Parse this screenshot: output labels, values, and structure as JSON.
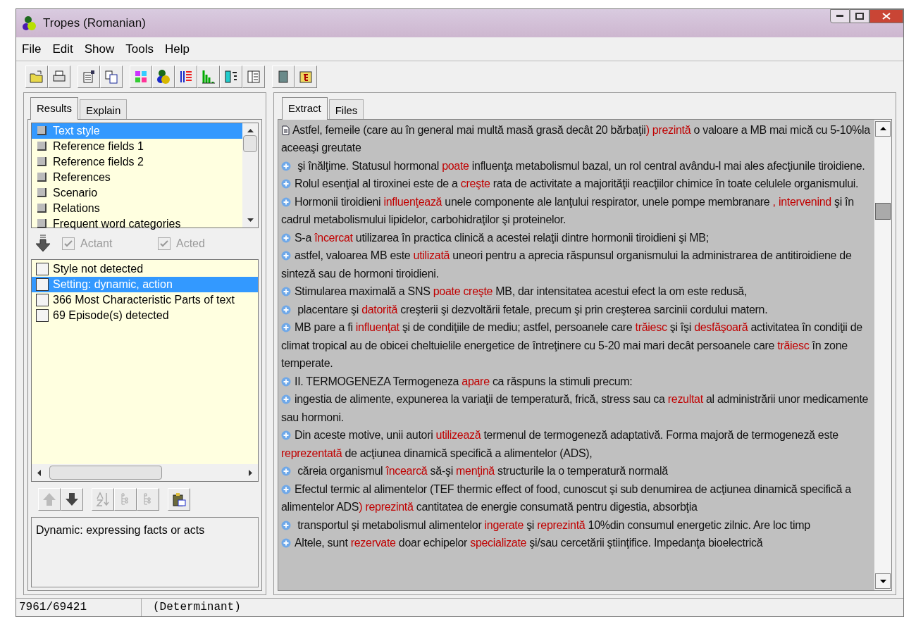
{
  "window": {
    "title": "Tropes (Romanian)"
  },
  "menu": [
    "File",
    "Edit",
    "Show",
    "Tools",
    "Help"
  ],
  "left_tabs": [
    {
      "label": "Results",
      "selected": true
    },
    {
      "label": "Explain",
      "selected": false
    }
  ],
  "results_list": [
    {
      "label": "Text style",
      "selected": true
    },
    {
      "label": "Reference fields 1",
      "selected": false
    },
    {
      "label": "Reference fields 2",
      "selected": false
    },
    {
      "label": "References",
      "selected": false
    },
    {
      "label": "Scenario",
      "selected": false
    },
    {
      "label": "Relations",
      "selected": false
    },
    {
      "label": "Frequent word categories",
      "selected": false
    }
  ],
  "filters": [
    {
      "label": "Actant",
      "checked": true,
      "disabled": true
    },
    {
      "label": "Acted",
      "checked": true,
      "disabled": true
    }
  ],
  "detail_list": [
    {
      "label": "Style not detected",
      "selected": false,
      "checked": false
    },
    {
      "label": "Setting: dynamic, action",
      "selected": true,
      "checked": false
    },
    {
      "label": "366 Most Characteristic Parts of text",
      "selected": false,
      "checked": false
    },
    {
      "label": "69 Episode(s) detected",
      "selected": false,
      "checked": false
    }
  ],
  "description": "Dynamic: expressing facts or acts",
  "right_tabs": [
    {
      "label": "Extract",
      "selected": true
    },
    {
      "label": "Files",
      "selected": false
    }
  ],
  "extract": [
    {
      "kind": "document",
      "segments": [
        {
          "text": "Astfel, femeile (care au în general mai multă masă grasă decât 20 bărbaţii",
          "verb": false
        },
        {
          "text": ") prezintă",
          "verb": true
        },
        {
          "text": " o valoare a MB mai mică cu 5-10%la aceeaşi greutate",
          "verb": false
        }
      ]
    },
    {
      "kind": "plus",
      "segments": [
        {
          "text": " şi înălţime. Statusul hormonal ",
          "verb": false
        },
        {
          "text": "poate",
          "verb": true
        },
        {
          "text": " influenţa metabolismul bazal, un rol central avându-l mai ales afecţiunile tiroidiene.",
          "verb": false
        }
      ]
    },
    {
      "kind": "plus",
      "segments": [
        {
          "text": "Rolul esenţial al tiroxinei este de a ",
          "verb": false
        },
        {
          "text": "creşte",
          "verb": true
        },
        {
          "text": " rata de activitate a majorităţii reacţiilor chimice în toate celulele organismului.",
          "verb": false
        }
      ]
    },
    {
      "kind": "plus",
      "segments": [
        {
          "text": "Hormonii tiroidieni ",
          "verb": false
        },
        {
          "text": "influenţează",
          "verb": true
        },
        {
          "text": " unele componente ale lanţului respirator,  unele pompe membranare ",
          "verb": false
        },
        {
          "text": ", intervenind",
          "verb": true
        },
        {
          "text": " şi în cadrul metabolismului lipidelor, carbohidraţilor şi proteinelor.",
          "verb": false
        }
      ]
    },
    {
      "kind": "plus",
      "segments": [
        {
          "text": "S-a ",
          "verb": false
        },
        {
          "text": "încercat",
          "verb": true
        },
        {
          "text": " utilizarea în practica clinică a acestei relaţii dintre hormonii tiroidieni şi MB;",
          "verb": false
        }
      ]
    },
    {
      "kind": "plus",
      "segments": [
        {
          "text": "astfel,  valoarea MB este ",
          "verb": false
        },
        {
          "text": "utilizată",
          "verb": true
        },
        {
          "text": " uneori pentru a aprecia răspunsul organismului la administrarea de antitiroidiene de sinteză sau de hormoni tiroidieni.",
          "verb": false
        }
      ]
    },
    {
      "kind": "plus",
      "segments": [
        {
          "text": "Stimularea maximală a SNS ",
          "verb": false
        },
        {
          "text": "poate creşte",
          "verb": true
        },
        {
          "text": " MB,  dar intensitatea acestui efect la om este redusă,",
          "verb": false
        }
      ]
    },
    {
      "kind": "plus",
      "segments": [
        {
          "text": " placentare şi ",
          "verb": false
        },
        {
          "text": "datorită",
          "verb": true
        },
        {
          "text": " creşterii şi dezvoltării fetale, precum şi prin creşterea sarcinii cordului matern.",
          "verb": false
        }
      ]
    },
    {
      "kind": "plus",
      "segments": [
        {
          "text": "MB pare a fi ",
          "verb": false
        },
        {
          "text": "influenţat",
          "verb": true
        },
        {
          "text": " şi de condiţiile de mediu; astfel, persoanele care ",
          "verb": false
        },
        {
          "text": "trăiesc",
          "verb": true
        },
        {
          "text": " şi îşi ",
          "verb": false
        },
        {
          "text": "desfăşoară",
          "verb": true
        },
        {
          "text": " activitatea în condiţii de climat tropical au de obicei cheltuielile energetice de întreţinere cu 5-20 mai mari decât persoanele care ",
          "verb": false
        },
        {
          "text": "trăiesc",
          "verb": true
        },
        {
          "text": " în zone temperate.",
          "verb": false
        }
      ]
    },
    {
      "kind": "plus",
      "segments": [
        {
          "text": "II. TERMOGENEZA Termogeneza ",
          "verb": false
        },
        {
          "text": "apare",
          "verb": true
        },
        {
          "text": " ca răspuns la stimuli precum:",
          "verb": false
        }
      ]
    },
    {
      "kind": "plus",
      "segments": [
        {
          "text": "ingestia de alimente, expunerea la variaţii de temperatură, frică, stress sau ca ",
          "verb": false
        },
        {
          "text": "rezultat",
          "verb": true
        },
        {
          "text": " al administrării unor medicamente sau hormoni.",
          "verb": false
        }
      ]
    },
    {
      "kind": "plus",
      "segments": [
        {
          "text": "Din aceste motive, unii autori ",
          "verb": false
        },
        {
          "text": "utilizează",
          "verb": true
        },
        {
          "text": " termenul de termogeneză adaptativă. Forma majoră de termogeneză este ",
          "verb": false
        },
        {
          "text": "reprezentată",
          "verb": true
        },
        {
          "text": " de acţiunea dinamică specifică a alimentelor (ADS),",
          "verb": false
        }
      ]
    },
    {
      "kind": "plus",
      "segments": [
        {
          "text": " căreia organismul ",
          "verb": false
        },
        {
          "text": "încearcă",
          "verb": true
        },
        {
          "text": "  să-şi ",
          "verb": false
        },
        {
          "text": "menţină",
          "verb": true
        },
        {
          "text": " structurile la o temperatură normală",
          "verb": false
        }
      ]
    },
    {
      "kind": "plus",
      "segments": [
        {
          "text": "Efectul termic al alimentelor (TEF thermic effect of food, cunoscut şi sub denumirea de acţiunea dinamică specifică a alimentelor ADS",
          "verb": false
        },
        {
          "text": ") reprezintă",
          "verb": true
        },
        {
          "text": " cantitatea de energie consumată pentru digestia, absorbţia",
          "verb": false
        }
      ]
    },
    {
      "kind": "plus",
      "segments": [
        {
          "text": " transportul şi metabolismul  alimentelor ",
          "verb": false
        },
        {
          "text": "ingerate",
          "verb": true
        },
        {
          "text": " şi ",
          "verb": false
        },
        {
          "text": "reprezintă",
          "verb": true
        },
        {
          "text": " 10%din consumul energetic zilnic. Are loc timp",
          "verb": false
        }
      ]
    },
    {
      "kind": "plus",
      "segments": [
        {
          "text": "Altele, sunt ",
          "verb": false
        },
        {
          "text": "rezervate",
          "verb": true
        },
        {
          "text": " doar echipelor ",
          "verb": false
        },
        {
          "text": "specializate",
          "verb": true
        },
        {
          "text": " şi/sau cercetării ştiinţifice. Impedanţa bioelectrică",
          "verb": false
        }
      ]
    }
  ],
  "status_bar": [
    "7961/69421",
    "(Determinant)"
  ]
}
